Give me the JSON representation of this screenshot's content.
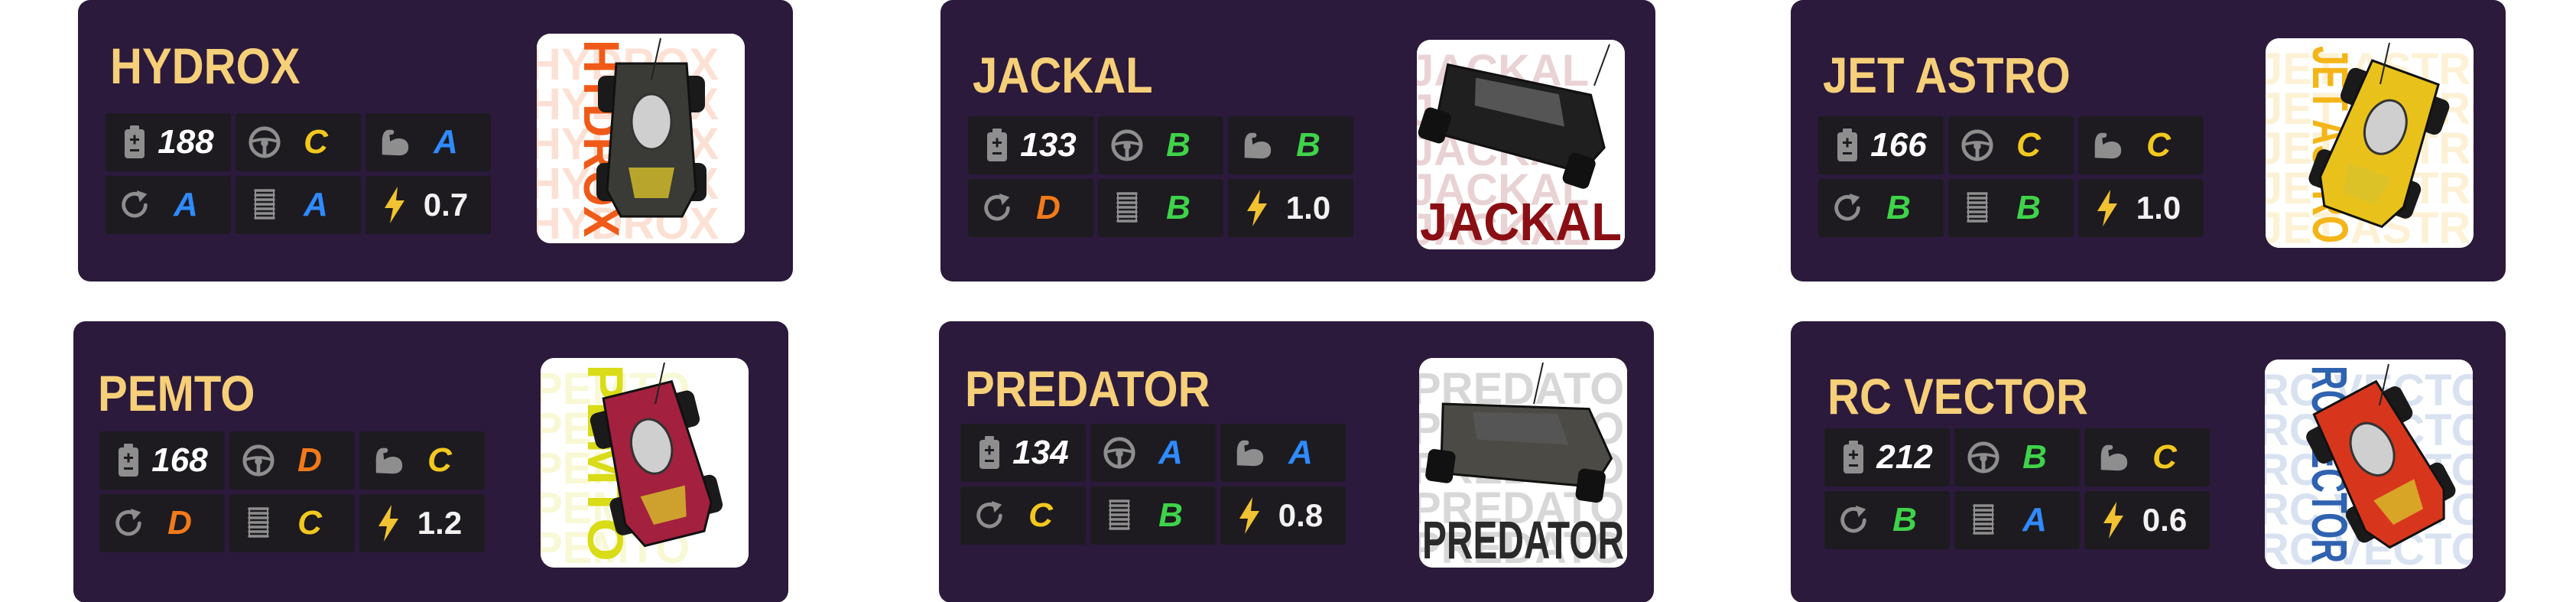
{
  "colors": {
    "card_bg": "#2b1a3b",
    "cell_bg": "#1d1b20",
    "title": "#f6cf79",
    "grade_A": "#2f8bff",
    "grade_B": "#3fd34a",
    "grade_C": "#f3c81e",
    "grade_D": "#f27a1a"
  },
  "stat_icons": [
    "battery-icon",
    "steering-wheel-icon",
    "muscle-arm-icon",
    "recharge-arrow-icon",
    "spring-icon",
    "lightning-icon"
  ],
  "cars": [
    {
      "name": "HYDROX",
      "battery": "188",
      "handling": "C",
      "strength": "A",
      "recharge": "A",
      "suspension": "A",
      "power": "0.7",
      "thumb_text": "HYDROX",
      "thumb_accent": "#f05a18",
      "car_color": "#3a3a36"
    },
    {
      "name": "JACKAL",
      "battery": "133",
      "handling": "B",
      "strength": "B",
      "recharge": "D",
      "suspension": "B",
      "power": "1.0",
      "thumb_text": "JACKAL",
      "thumb_accent": "#8a0f14",
      "car_color": "#1f1f1f"
    },
    {
      "name": "JET ASTRO",
      "battery": "166",
      "handling": "C",
      "strength": "C",
      "recharge": "B",
      "suspension": "B",
      "power": "1.0",
      "thumb_text": "JET ASTRO",
      "thumb_accent": "#f4b518",
      "car_color": "#e8c21a"
    },
    {
      "name": "PEMTO",
      "battery": "168",
      "handling": "D",
      "strength": "C",
      "recharge": "D",
      "suspension": "C",
      "power": "1.2",
      "thumb_text": "PEMTO",
      "thumb_accent": "#d9dc16",
      "car_color": "#a3203e"
    },
    {
      "name": "PREDATOR",
      "battery": "134",
      "handling": "A",
      "strength": "A",
      "recharge": "C",
      "suspension": "B",
      "power": "0.8",
      "thumb_text": "PREDATOR",
      "thumb_accent": "#2a2a2a",
      "car_color": "#4b4a44"
    },
    {
      "name": "RC VECTOR",
      "battery": "212",
      "handling": "B",
      "strength": "C",
      "recharge": "B",
      "suspension": "A",
      "power": "0.6",
      "thumb_text": "RC VECTOR",
      "thumb_accent": "#2f62b0",
      "car_color": "#d8361c"
    }
  ]
}
